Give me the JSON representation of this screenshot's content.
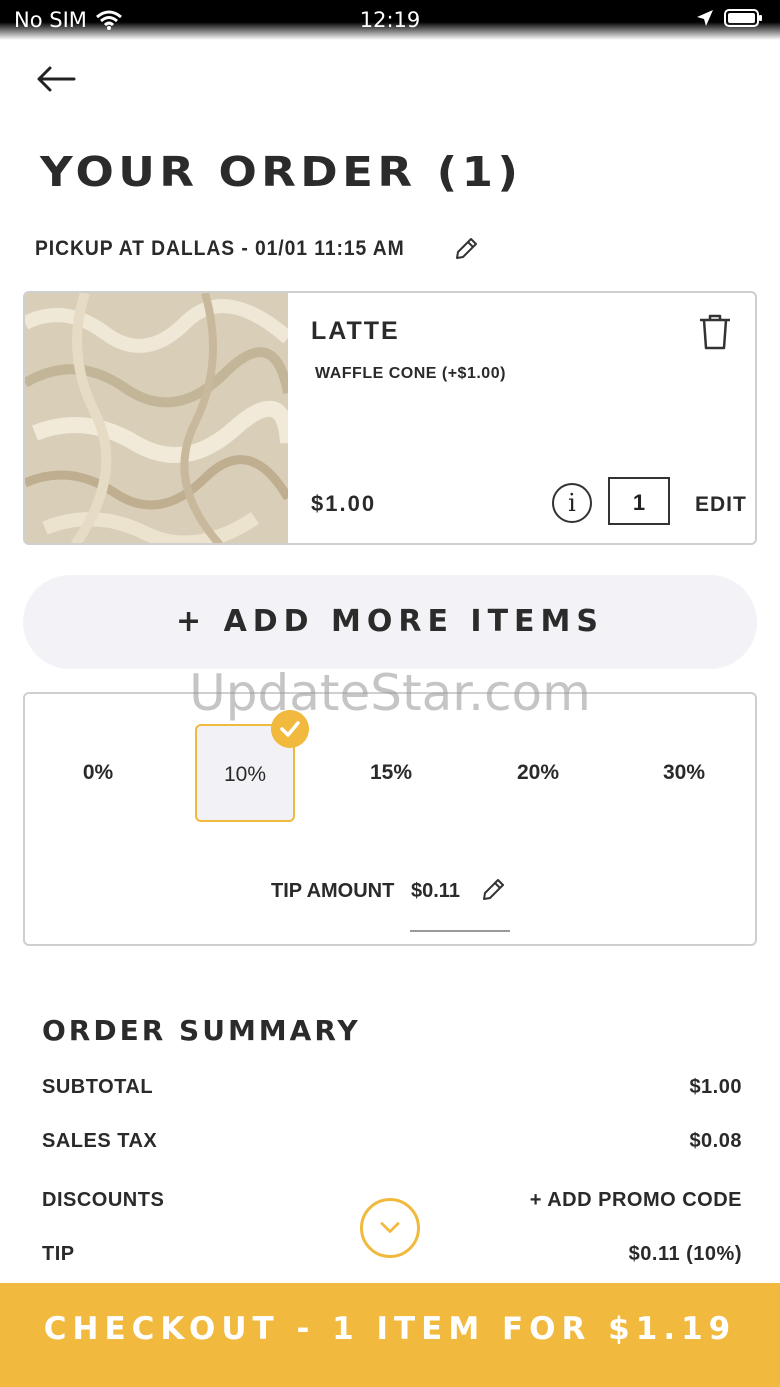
{
  "status_bar": {
    "carrier": "No SIM",
    "time": "12:19"
  },
  "header": {
    "title": "YOUR ORDER (1)",
    "pickup_text": "PICKUP AT DALLAS - 01/01 11:15 AM"
  },
  "item": {
    "name": "LATTE",
    "modifier": "WAFFLE CONE (+$1.00)",
    "price": "$1.00",
    "quantity": "1",
    "edit_label": "EDIT",
    "info_glyph": "i"
  },
  "add_more_label": "+ ADD MORE ITEMS",
  "watermark": "UpdateStar.com",
  "tip": {
    "options": [
      "0%",
      "10%",
      "15%",
      "20%",
      "30%"
    ],
    "selected": "10%",
    "amount_label": "TIP AMOUNT",
    "amount_value": "$0.11"
  },
  "summary": {
    "title": "ORDER SUMMARY",
    "rows": [
      {
        "label": "SUBTOTAL",
        "value": "$1.00"
      },
      {
        "label": "SALES TAX",
        "value": "$0.08"
      },
      {
        "label": "DISCOUNTS",
        "value": "+ ADD PROMO CODE"
      },
      {
        "label": "TIP",
        "value": "$0.11 (10%)"
      }
    ]
  },
  "checkout_label": "CHECKOUT - 1 ITEM FOR $1.19",
  "colors": {
    "accent": "#f1b93d",
    "card_border": "#cfcfcf",
    "pill_bg": "#f3f3f7"
  },
  "icons": [
    "wifi-icon",
    "location-icon",
    "battery-icon",
    "back-arrow-icon",
    "pencil-icon",
    "trash-icon",
    "info-icon",
    "check-icon",
    "chevron-down-icon"
  ]
}
